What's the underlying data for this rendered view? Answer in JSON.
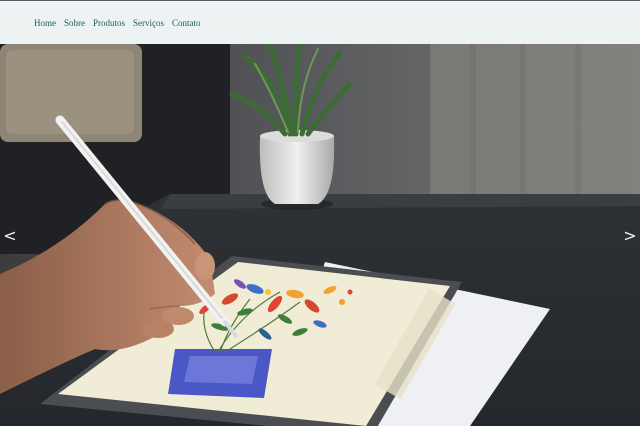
{
  "nav": {
    "items": [
      {
        "label": "Home"
      },
      {
        "label": "Sobre"
      },
      {
        "label": "Produtos"
      },
      {
        "label": "Serviços"
      },
      {
        "label": "Contato"
      }
    ]
  },
  "slider": {
    "prev_glyph": "<",
    "next_glyph": ">",
    "prev_icon": "chevron-left-icon",
    "next_icon": "chevron-right-icon"
  },
  "colors": {
    "nav_background": "#edf3f2",
    "nav_link": "#1f5d56"
  }
}
